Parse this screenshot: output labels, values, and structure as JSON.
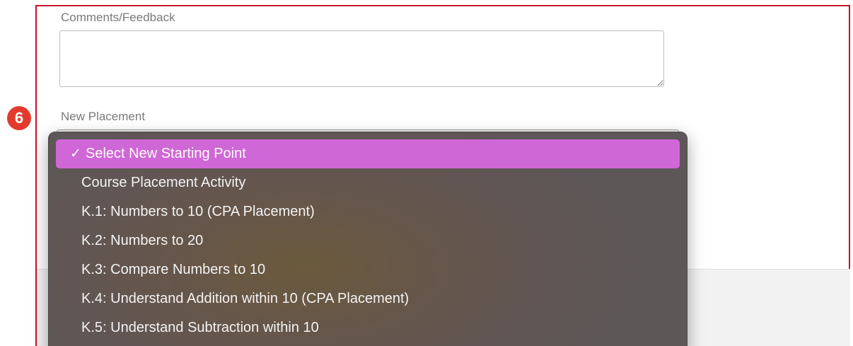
{
  "step_badge": "6",
  "form": {
    "comments_label": "Comments/Feedback",
    "comments_value": "",
    "placement_label": "New Placement"
  },
  "dropdown": {
    "check_glyph": "✓",
    "options": [
      {
        "label": "Select New Starting Point",
        "selected": true
      },
      {
        "label": "Course Placement Activity",
        "selected": false
      },
      {
        "label": "K.1: Numbers to 10 (CPA Placement)",
        "selected": false
      },
      {
        "label": "K.2: Numbers to 20",
        "selected": false
      },
      {
        "label": "K.3: Compare Numbers to 10",
        "selected": false
      },
      {
        "label": "K.4: Understand Addition within 10 (CPA Placement)",
        "selected": false
      },
      {
        "label": "K.5: Understand Subtraction within 10",
        "selected": false
      }
    ]
  },
  "colors": {
    "frame_border": "#c8102e",
    "badge": "#e23b2e",
    "selected_highlight": "#d067d6",
    "menu_background": "#605655"
  }
}
